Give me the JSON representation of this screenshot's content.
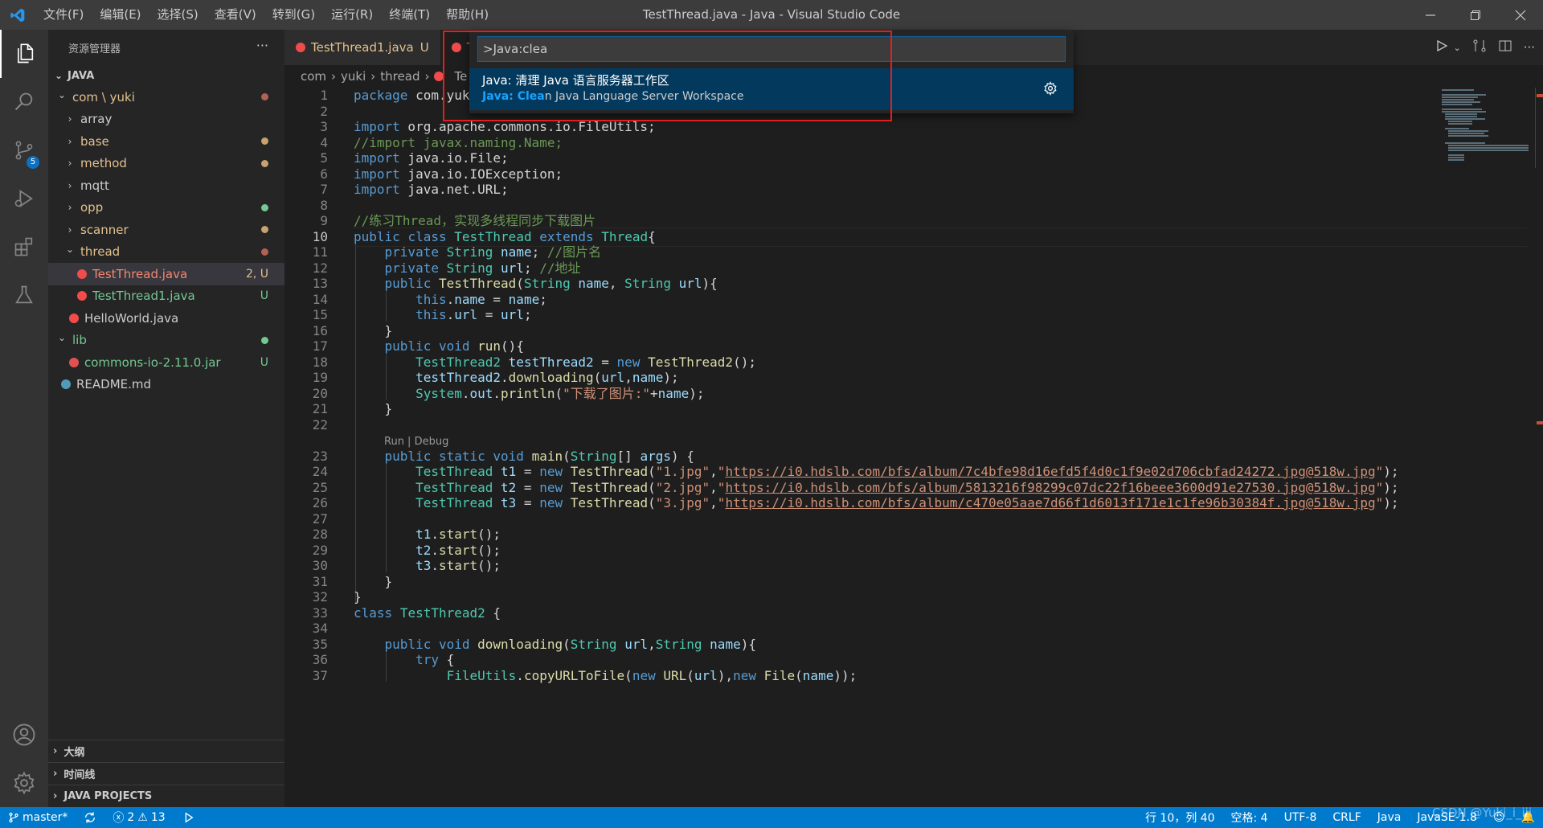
{
  "window": {
    "title": "TestThread.java - Java - Visual Studio Code",
    "menu": [
      "文件(F)",
      "编辑(E)",
      "选择(S)",
      "查看(V)",
      "转到(G)",
      "运行(R)",
      "终端(T)",
      "帮助(H)"
    ]
  },
  "activity": {
    "scm_badge": "5"
  },
  "sidebar": {
    "title": "资源管理器",
    "more": "···",
    "workspace": "JAVA",
    "tree": [
      {
        "label": "com \\ yuki",
        "indent": 1,
        "chevron": "down",
        "color": "#e2c08d",
        "dot": "#b26156"
      },
      {
        "label": "array",
        "indent": 2,
        "chevron": "right",
        "color": "#cccccc"
      },
      {
        "label": "base",
        "indent": 2,
        "chevron": "right",
        "color": "#e2c08d",
        "dot": "#c9a26d"
      },
      {
        "label": "method",
        "indent": 2,
        "chevron": "right",
        "color": "#e2c08d",
        "dot": "#c9a26d"
      },
      {
        "label": "mqtt",
        "indent": 2,
        "chevron": "right",
        "color": "#cccccc"
      },
      {
        "label": "opp",
        "indent": 2,
        "chevron": "right",
        "color": "#e2c08d",
        "dot": "#73c991"
      },
      {
        "label": "scanner",
        "indent": 2,
        "chevron": "right",
        "color": "#e2c08d",
        "dot": "#c9a26d"
      },
      {
        "label": "thread",
        "indent": 2,
        "chevron": "down",
        "color": "#e2c08d",
        "dot": "#b26156"
      },
      {
        "label": "TestThread.java",
        "indent": 3,
        "icon": "#f14c4c",
        "color": "#f48771",
        "status": "2, U",
        "status_color": "#e2c08d",
        "selected": true
      },
      {
        "label": "TestThread1.java",
        "indent": 3,
        "icon": "#f14c4c",
        "color": "#73c991",
        "status": "U",
        "status_color": "#73c991"
      },
      {
        "label": "HelloWorld.java",
        "indent": 2,
        "icon": "#f14c4c",
        "color": "#cccccc"
      },
      {
        "label": "lib",
        "indent": 1,
        "chevron": "down",
        "color": "#73c991",
        "dot": "#73c991"
      },
      {
        "label": "commons-io-2.11.0.jar",
        "indent": 2,
        "icon": "#e05252",
        "color": "#73c991",
        "status": "U",
        "status_color": "#73c991"
      },
      {
        "label": "README.md",
        "indent": 1,
        "icon": "#519aba",
        "color": "#cccccc"
      }
    ],
    "bottom_sections": [
      "大纲",
      "时间线",
      "JAVA PROJECTS"
    ]
  },
  "tabs": [
    {
      "label": "TestThread1.java",
      "status": "U"
    },
    {
      "label": "Te",
      "status": ""
    }
  ],
  "breadcrumb": [
    "com",
    "yuki",
    "thread",
    "Te"
  ],
  "command_palette": {
    "input_value": ">Java:clea",
    "item_title": "Java: 清理 Java 语言服务器工作区",
    "item_detail_highlight": "Java: Clea",
    "item_detail_rest": "n Java Language Server Workspace"
  },
  "editor": {
    "current_line": 10,
    "codelens": "Run | Debug",
    "lines": [
      {
        "n": 1,
        "html": "<span class='kw'>package</span> com.yuki.thread;"
      },
      {
        "n": 2,
        "html": ""
      },
      {
        "n": 3,
        "html": "<span class='kw'>import</span> org.apache.commons.io.FileUtils;"
      },
      {
        "n": 4,
        "html": "<span class='cm'>//import javax.naming.Name;</span>"
      },
      {
        "n": 5,
        "html": "<span class='kw'>import</span> java.io.File;"
      },
      {
        "n": 6,
        "html": "<span class='kw'>import</span> java.io.IOException;"
      },
      {
        "n": 7,
        "html": "<span class='kw'>import</span> java.net.URL;"
      },
      {
        "n": 8,
        "html": ""
      },
      {
        "n": 9,
        "html": "<span class='cm'>//练习Thread，实现多线程同步下载图片</span>"
      },
      {
        "n": 10,
        "html": "<span class='kw'>public</span> <span class='kw'>class</span> <span class='ty'>TestThread</span> <span class='kw'>extends</span> <span class='ty'>Thread</span>{"
      },
      {
        "n": 11,
        "html": "    <span class='kw'>private</span> <span class='ty'>String</span> <span class='vr'>name</span>; <span class='cm'>//图片名</span>"
      },
      {
        "n": 12,
        "html": "    <span class='kw'>private</span> <span class='ty'>String</span> <span class='vr'>url</span>; <span class='cm'>//地址</span>"
      },
      {
        "n": 13,
        "html": "    <span class='kw'>public</span> <span class='fn'>TestThread</span>(<span class='ty'>String</span> <span class='vr'>name</span>, <span class='ty'>String</span> <span class='vr'>url</span>){"
      },
      {
        "n": 14,
        "html": "        <span class='kw'>this</span>.<span class='vr'>name</span> = <span class='vr'>name</span>;"
      },
      {
        "n": 15,
        "html": "        <span class='kw'>this</span>.<span class='vr'>url</span> = <span class='vr'>url</span>;"
      },
      {
        "n": 16,
        "html": "    }"
      },
      {
        "n": 17,
        "html": "    <span class='kw'>public</span> <span class='kw'>void</span> <span class='fn'>run</span>(){"
      },
      {
        "n": 18,
        "html": "        <span class='ty'>TestThread2</span> <span class='vr'>testThread2</span> = <span class='kw'>new</span> <span class='fn'>TestThread2</span>();"
      },
      {
        "n": 19,
        "html": "        <span class='vr'>testThread2</span>.<span class='fn'>downloading</span>(<span class='vr'>url</span>,<span class='vr'>name</span>);"
      },
      {
        "n": 20,
        "html": "        <span class='ty'>System</span>.<span class='vr'>out</span>.<span class='fn'>println</span>(<span class='str'>\"下载了图片:\"</span>+<span class='vr'>name</span>);"
      },
      {
        "n": 21,
        "html": "    }"
      },
      {
        "n": 22,
        "html": ""
      },
      {
        "n": 23,
        "html": "    <span class='kw'>public</span> <span class='kw'>static</span> <span class='kw'>void</span> <span class='fn'>main</span>(<span class='ty'>String</span>[] <span class='vr'>args</span>) {"
      },
      {
        "n": 24,
        "html": "        <span class='ty'>TestThread</span> <span class='vr'>t1</span> = <span class='kw'>new</span> <span class='fn'>TestThread</span>(<span class='str'>\"1.jpg\"</span>,<span class='str'>\"</span><span class='url'>https://i0.hdslb.com/bfs/album/7c4bfe98d16efd5f4d0c1f9e02d706cbfad24272.jpg@518w.jpg</span><span class='str'>\"</span>);"
      },
      {
        "n": 25,
        "html": "        <span class='ty'>TestThread</span> <span class='vr'>t2</span> = <span class='kw'>new</span> <span class='fn'>TestThread</span>(<span class='str'>\"2.jpg\"</span>,<span class='str'>\"</span><span class='url'>https://i0.hdslb.com/bfs/album/5813216f98299c07dc22f16beee3600d91e27530.jpg@518w.jpg</span><span class='str'>\"</span>);"
      },
      {
        "n": 26,
        "html": "        <span class='ty'>TestThread</span> <span class='vr'>t3</span> = <span class='kw'>new</span> <span class='fn'>TestThread</span>(<span class='str'>\"3.jpg\"</span>,<span class='str'>\"</span><span class='url'>https://i0.hdslb.com/bfs/album/c470e05aae7d66f1d6013f171e1c1fe96b30384f.jpg@518w.jpg</span><span class='str'>\"</span>);"
      },
      {
        "n": 27,
        "html": ""
      },
      {
        "n": 28,
        "html": "        <span class='vr'>t1</span>.<span class='fn'>start</span>();"
      },
      {
        "n": 29,
        "html": "        <span class='vr'>t2</span>.<span class='fn'>start</span>();"
      },
      {
        "n": 30,
        "html": "        <span class='vr'>t3</span>.<span class='fn'>start</span>();"
      },
      {
        "n": 31,
        "html": "    }"
      },
      {
        "n": 32,
        "html": "}"
      },
      {
        "n": 33,
        "html": "<span class='kw'>class</span> <span class='ty'>TestThread2</span> {"
      },
      {
        "n": 34,
        "html": ""
      },
      {
        "n": 35,
        "html": "    <span class='kw'>public</span> <span class='kw'>void</span> <span class='fn'>downloading</span>(<span class='ty'>String</span> <span class='vr'>url</span>,<span class='ty'>String</span> <span class='vr'>name</span>){"
      },
      {
        "n": 36,
        "html": "        <span class='kw'>try</span> {"
      },
      {
        "n": 37,
        "html": "            <span class='ty'>FileUtils</span>.<span class='fn'>copyURLToFile</span>(<span class='kw'>new</span> <span class='fn'>URL</span>(<span class='vr'>url</span>),<span class='kw'>new</span> <span class='fn'>File</span>(<span class='vr'>name</span>));"
      }
    ]
  },
  "statusbar": {
    "branch": "master*",
    "errors": "2",
    "warnings": "13",
    "position": "行 10，列 40",
    "indent": "空格: 4",
    "encoding": "UTF-8",
    "eol": "CRLF",
    "language": "Java",
    "extra": "JavaSE-1.8",
    "watermark": "CSDN @Yuki_i_iii"
  },
  "colors": {
    "accent": "#007acc",
    "activity_bg": "#333333",
    "sidebar_bg": "#252526",
    "editor_bg": "#1e1e1e"
  }
}
